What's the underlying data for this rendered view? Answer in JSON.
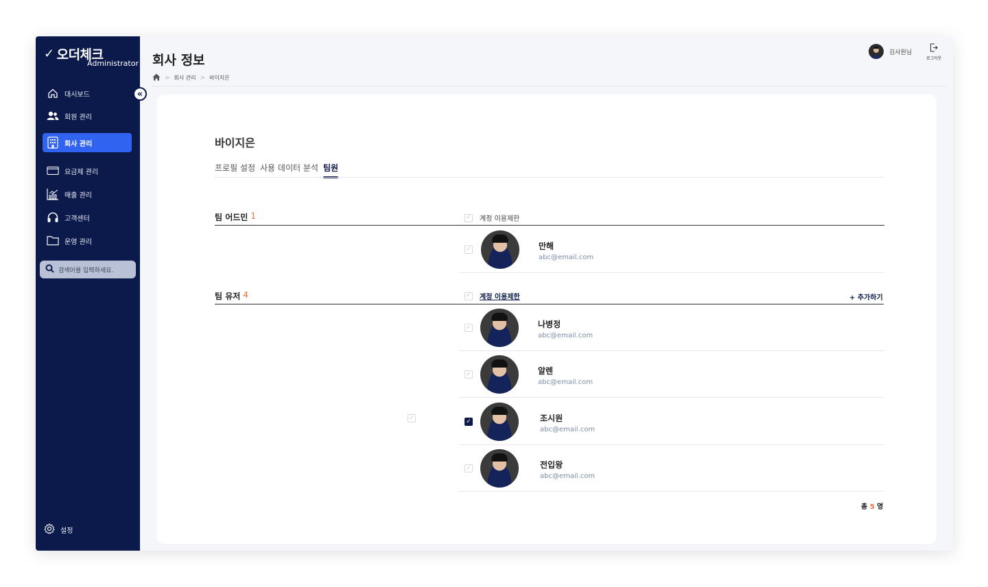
{
  "sidebar": {
    "brand": "오더체크",
    "brand_check": "✓",
    "brand_sub": "Administrator",
    "collapse_icon": "«",
    "items": [
      {
        "label": "대시보드",
        "icon": "home-icon",
        "active": false
      },
      {
        "label": "회원 관리",
        "icon": "users-icon",
        "active": false
      },
      {
        "label": "회사 관리",
        "icon": "building-icon",
        "active": true
      },
      {
        "label": "요금제 관리",
        "icon": "card-icon",
        "active": false
      },
      {
        "label": "매출 관리",
        "icon": "chart-icon",
        "active": false
      },
      {
        "label": "고객센터",
        "icon": "headset-icon",
        "active": false
      },
      {
        "label": "운영 관리",
        "icon": "folder-icon",
        "active": false
      }
    ],
    "search_placeholder": "검색어를 입력하세요.",
    "settings_label": "설정"
  },
  "header": {
    "title": "회사 정보",
    "breadcrumb": [
      "회사 관리",
      "바이지은"
    ],
    "user_name": "김사원님",
    "logout_label": "로그아웃"
  },
  "main": {
    "company_name": "바이지은",
    "tabs": [
      {
        "label": "프로필 설정",
        "active": false
      },
      {
        "label": "사용 데이터 분석",
        "active": false
      },
      {
        "label": "팀원",
        "active": true
      }
    ],
    "admins": {
      "label": "팀 어드민",
      "count": "1",
      "column_label": "계정 이용제한",
      "members": [
        {
          "name": "만해",
          "email": "abc@email.com",
          "checked": false
        }
      ]
    },
    "users": {
      "label": "팀 유저",
      "count": "4",
      "column_label": "계정 이용제한",
      "add_label": "+ 추가하기",
      "members": [
        {
          "name": "나병정",
          "email": "abc@email.com",
          "checked": false
        },
        {
          "name": "알렌",
          "email": "abc@email.com",
          "checked": false
        },
        {
          "name": "조시원",
          "email": "abc@email.com",
          "checked": true
        },
        {
          "name": "전입왕",
          "email": "abc@email.com",
          "checked": false
        }
      ]
    },
    "total_prefix": "총",
    "total_count": "5",
    "total_suffix": "명"
  },
  "colors": {
    "sidebar_bg": "#0b1a4b",
    "active_nav": "#2f63f0",
    "accent_count": "#f26b3a"
  }
}
